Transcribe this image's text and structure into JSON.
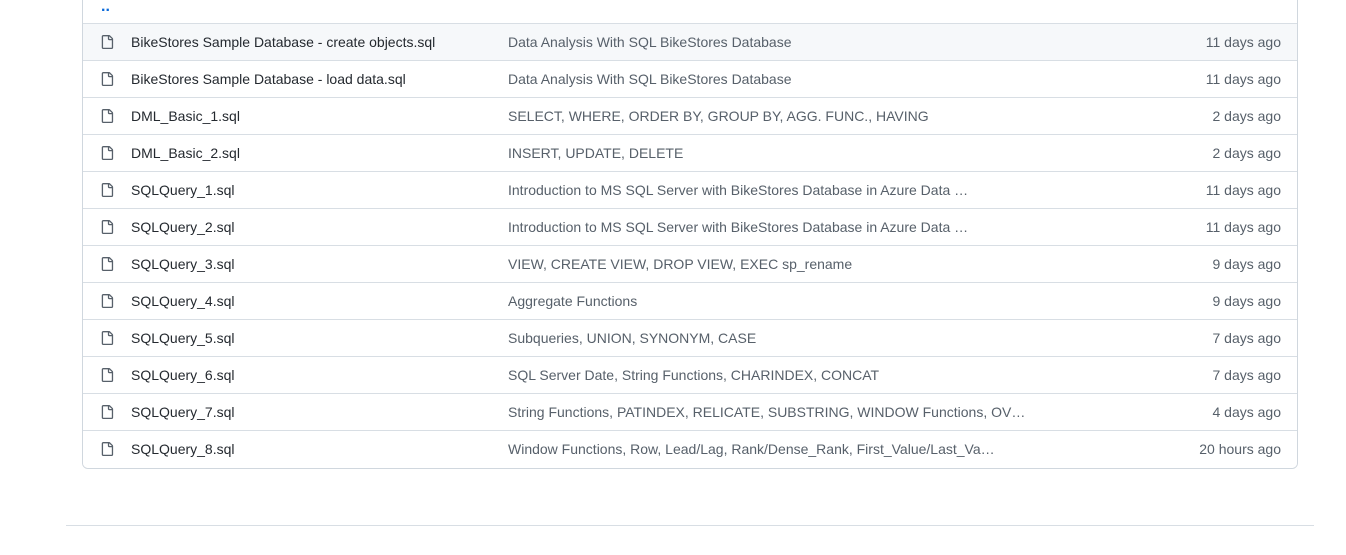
{
  "parent_dir": {
    "label": ".."
  },
  "files": [
    {
      "name": "BikeStores Sample Database - create objects.sql",
      "message": "Data Analysis With SQL BikeStores Database",
      "age": "11 days ago",
      "icon": "file-icon"
    },
    {
      "name": "BikeStores Sample Database - load data.sql",
      "message": "Data Analysis With SQL BikeStores Database",
      "age": "11 days ago",
      "icon": "file-icon"
    },
    {
      "name": "DML_Basic_1.sql",
      "message": "SELECT, WHERE, ORDER BY, GROUP BY, AGG. FUNC., HAVING",
      "age": "2 days ago",
      "icon": "file-icon"
    },
    {
      "name": "DML_Basic_2.sql",
      "message": "INSERT, UPDATE, DELETE",
      "age": "2 days ago",
      "icon": "file-icon"
    },
    {
      "name": "SQLQuery_1.sql",
      "message": "Introduction to MS SQL Server with BikeStores Database in Azure Data …",
      "age": "11 days ago",
      "icon": "file-icon"
    },
    {
      "name": "SQLQuery_2.sql",
      "message": "Introduction to MS SQL Server with BikeStores Database in Azure Data …",
      "age": "11 days ago",
      "icon": "file-icon"
    },
    {
      "name": "SQLQuery_3.sql",
      "message": "VIEW, CREATE VIEW, DROP VIEW, EXEC sp_rename",
      "age": "9 days ago",
      "icon": "file-icon"
    },
    {
      "name": "SQLQuery_4.sql",
      "message": "Aggregate Functions",
      "age": "9 days ago",
      "icon": "file-icon"
    },
    {
      "name": "SQLQuery_5.sql",
      "message": "Subqueries, UNION, SYNONYM, CASE",
      "age": "7 days ago",
      "icon": "file-icon"
    },
    {
      "name": "SQLQuery_6.sql",
      "message": "SQL Server Date, String Functions, CHARINDEX, CONCAT",
      "age": "7 days ago",
      "icon": "file-icon"
    },
    {
      "name": "SQLQuery_7.sql",
      "message": "String Functions, PATINDEX, RELICATE, SUBSTRING, WINDOW Functions, OV…",
      "age": "4 days ago",
      "icon": "file-icon"
    },
    {
      "name": "SQLQuery_8.sql",
      "message": "Window Functions, Row, Lead/Lag, Rank/Dense_Rank, First_Value/Last_Va…",
      "age": "20 hours ago",
      "icon": "file-icon"
    }
  ],
  "colors": {
    "link": "#0969da",
    "text": "#24292f",
    "muted": "#57606a",
    "border": "#d0d7de",
    "hover_row": "#f6f8fa"
  }
}
